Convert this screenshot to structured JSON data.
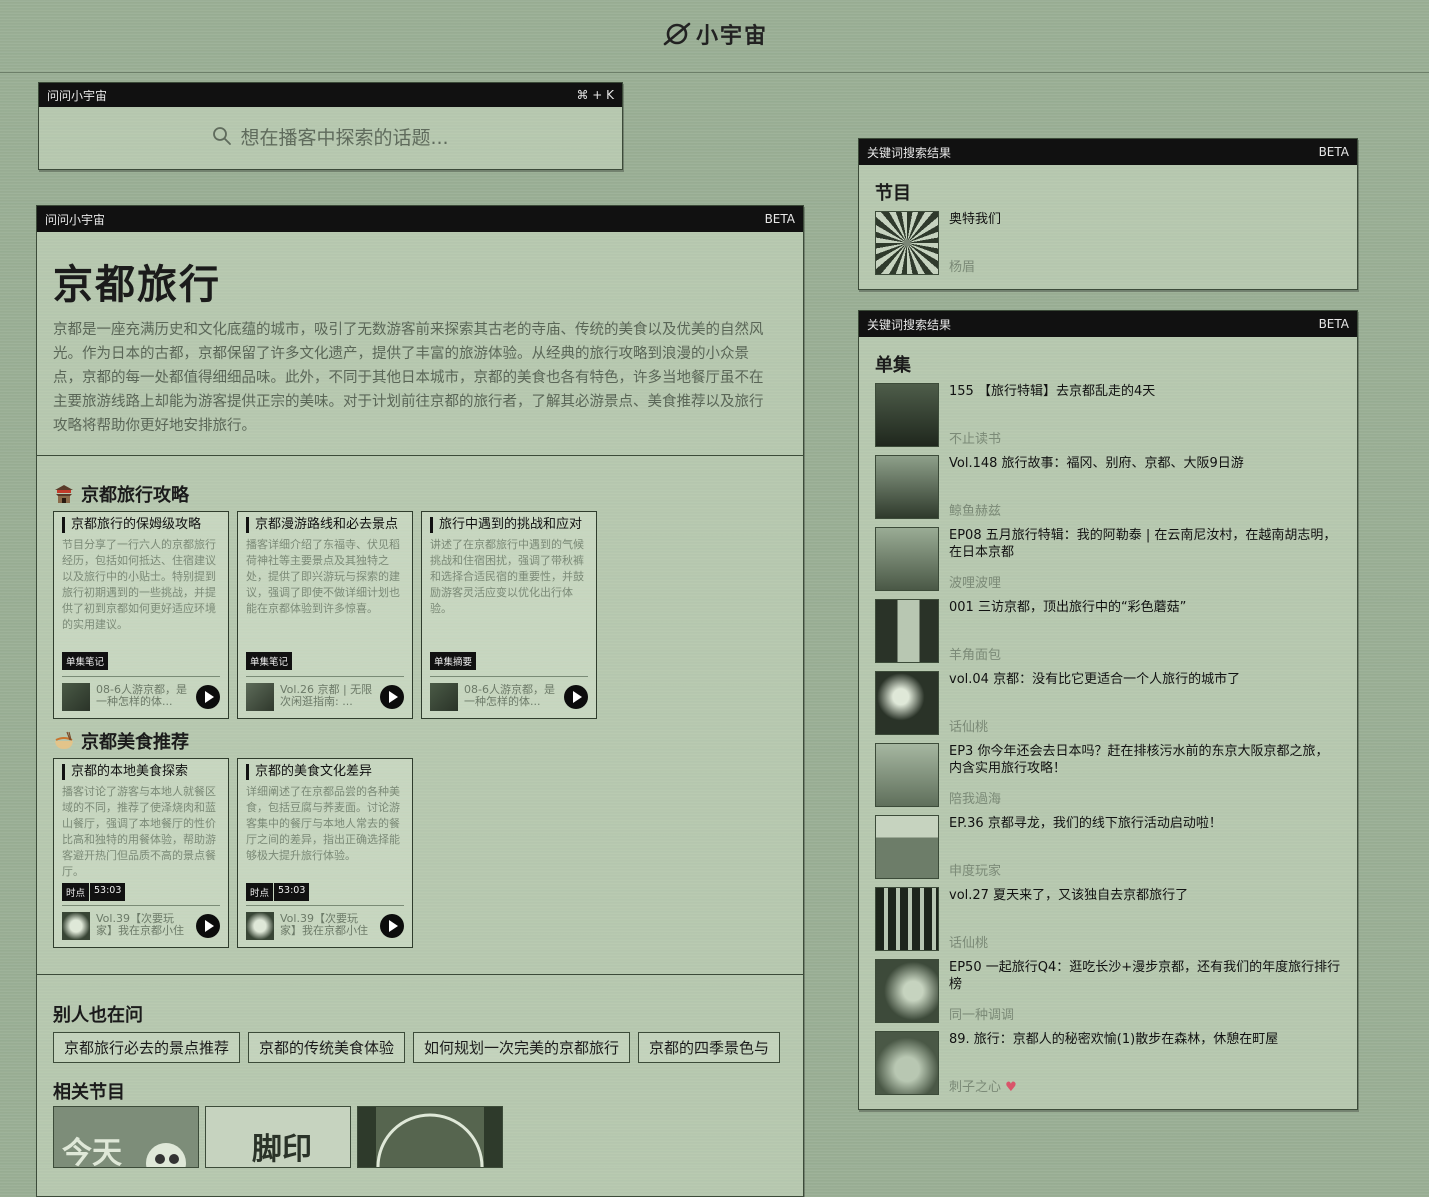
{
  "app": {
    "logo_text": "小宇宙"
  },
  "search": {
    "header_title": "问问小宇宙",
    "shortcut": "⌘ + K",
    "placeholder": "想在播客中探索的话题..."
  },
  "main": {
    "header_title": "问问小宇宙",
    "header_badge": "BETA",
    "topic_title": "京都旅行",
    "topic_desc": "京都是一座充满历史和文化底蕴的城市，吸引了无数游客前来探索其古老的寺庙、传统的美食以及优美的自然风光。作为日本的古都，京都保留了许多文化遗产，提供了丰富的旅游体验。从经典的旅行攻略到浪漫的小众景点，京都的每一处都值得细细品味。此外，不同于其他日本城市，京都的美食也各有特色，许多当地餐厅虽不在主要旅游线路上却能为游客提供正宗的美味。对于计划前往京都的旅行者，了解其必游景点、美食推荐以及旅行攻略将帮助你更好地安排旅行。",
    "section1_title": "京都旅行攻略",
    "section1_cards": [
      {
        "title": "京都旅行的保姆级攻略",
        "body": "节目分享了一行六人的京都旅行经历，包括如何抵达、住宿建议以及旅行中的小贴士。特别提到旅行初期遇到的一些挑战，并提供了初到京都如何更好适应环境的实用建议。",
        "badge": [
          "单集笔记"
        ],
        "foot": "08-6人游京都，是一种怎样的体..."
      },
      {
        "title": "京都漫游路线和必去景点",
        "body": "播客详细介绍了东福寺、伏见稻荷神社等主要景点及其独特之处，提供了即兴游玩与探索的建议，强调了即使不做详细计划也能在京都体验到许多惊喜。",
        "badge": [
          "单集笔记"
        ],
        "foot": "Vol.26 京都 | 无限次闲逛指南: ..."
      },
      {
        "title": "旅行中遇到的挑战和应对",
        "body": "讲述了在京都旅行中遇到的气候挑战和住宿困扰，强调了带秋裤和选择合适民宿的重要性，并鼓励游客灵活应变以优化出行体验。",
        "badge": [
          "单集摘要"
        ],
        "foot": "08-6人游京都，是一种怎样的体..."
      }
    ],
    "section2_title": "京都美食推荐",
    "section2_cards": [
      {
        "title": "京都的本地美食探索",
        "body": "播客讨论了游客与本地人就餐区域的不同，推荐了使泽烧肉和蓝山餐厅，强调了本地餐厅的性价比高和独特的用餐体验，帮助游客避开热门但品质不高的景点餐厅。",
        "badge": [
          "时点",
          "53:03"
        ],
        "foot": "Vol.39【次要玩家】我在京都小住"
      },
      {
        "title": "京都的美食文化差异",
        "body": "详细阐述了在京都品尝的各种美食，包括豆腐与荞麦面。讨论游客集中的餐厅与本地人常去的餐厅之间的差异，指出正确选择能够极大提升旅行体验。",
        "badge": [
          "时点",
          "53:03"
        ],
        "foot": "Vol.39【次要玩家】我在京都小住"
      }
    ],
    "also_asked_title": "别人也在问",
    "also_asked": [
      "京都旅行必去的景点推荐",
      "京都的传统美食体验",
      "如何规划一次完美的京都旅行",
      "京都的四季景色与"
    ],
    "related_title": "相关节目"
  },
  "right_shows": {
    "header_title": "关键词搜索结果",
    "header_badge": "BETA",
    "section_title": "节目",
    "items": [
      {
        "title": "奥特我们",
        "author": "杨眉"
      }
    ]
  },
  "right_episodes": {
    "header_title": "关键词搜索结果",
    "header_badge": "BETA",
    "section_title": "单集",
    "items": [
      {
        "title": "155 【旅行特辑】去京都乱走的4天",
        "author": "不止读书"
      },
      {
        "title": "Vol.148 旅行故事：福冈、别府、京都、大阪9日游",
        "author": "鲸鱼赫兹"
      },
      {
        "title": "EP08 五月旅行特辑：我的阿勒泰 | 在云南尼汝村，在越南胡志明，在日本京都",
        "author": "波哩波哩"
      },
      {
        "title": "001 三访京都，顶出旅行中的“彩色蘑菇”",
        "author": "羊角面包"
      },
      {
        "title": "vol.04 京都：没有比它更适合一个人旅行的城市了",
        "author": "话仙桃"
      },
      {
        "title": "EP3 你今年还会去日本吗？赶在排核污水前的东京大阪京都之旅，内含实用旅行攻略！",
        "author": "陪我過海"
      },
      {
        "title": "EP.36 京都寻龙，我们的线下旅行活动启动啦！",
        "author": "申度玩家"
      },
      {
        "title": "vol.27 夏天来了，又该独自去京都旅行了",
        "author": "话仙桃"
      },
      {
        "title": "EP50 一起旅行Q4：逛吃长沙+漫步京都，还有我们的年度旅行排行榜",
        "author": "同一种调调"
      },
      {
        "title": "89. 旅行：京都人的秘密欢愉(1)散步在森林，休憩在町屋",
        "author": "刺子之心"
      }
    ]
  }
}
